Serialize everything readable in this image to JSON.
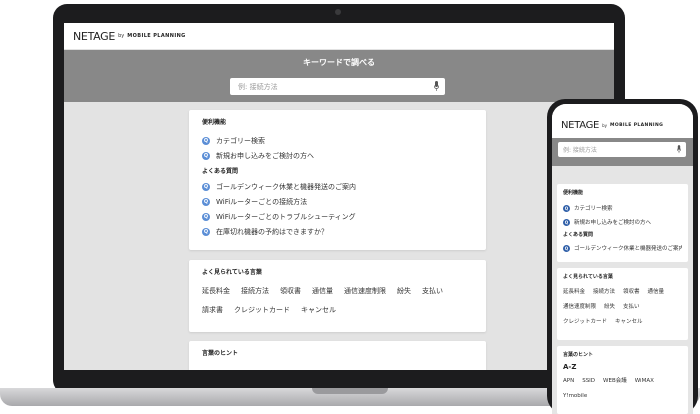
{
  "brand": {
    "logo": "NETAGE",
    "by": "by",
    "company": "MOBILE PLANNING"
  },
  "search": {
    "title": "キーワードで調べる",
    "placeholder": "例: 接続方法"
  },
  "convenience": {
    "title": "便利機能",
    "items": [
      "カテゴリー検索",
      "新規お申し込みをご検討の方へ"
    ]
  },
  "faq": {
    "title": "よくある質問",
    "items": [
      "ゴールデンウィーク休業と機器発送のご案内",
      "WiFiルーターごとの接続方法",
      "WiFiルーターごとのトラブルシューティング",
      "在庫切れ機器の予約はできますか？"
    ],
    "badge": "Q"
  },
  "popular": {
    "title": "よく見られている言葉",
    "tags": [
      "延長料金",
      "接続方法",
      "領収書",
      "通信量",
      "通信速度制限",
      "紛失",
      "支払い",
      "請求書",
      "クレジットカード",
      "キャンセル"
    ]
  },
  "hints": {
    "title": "言葉のヒント",
    "az": "A-Z",
    "tags": [
      "APN",
      "SSID",
      "WEB会議",
      "WiMAX",
      "Y!mobile"
    ]
  },
  "colors": {
    "hero": "#888888",
    "badge": "#5b8ed6"
  }
}
